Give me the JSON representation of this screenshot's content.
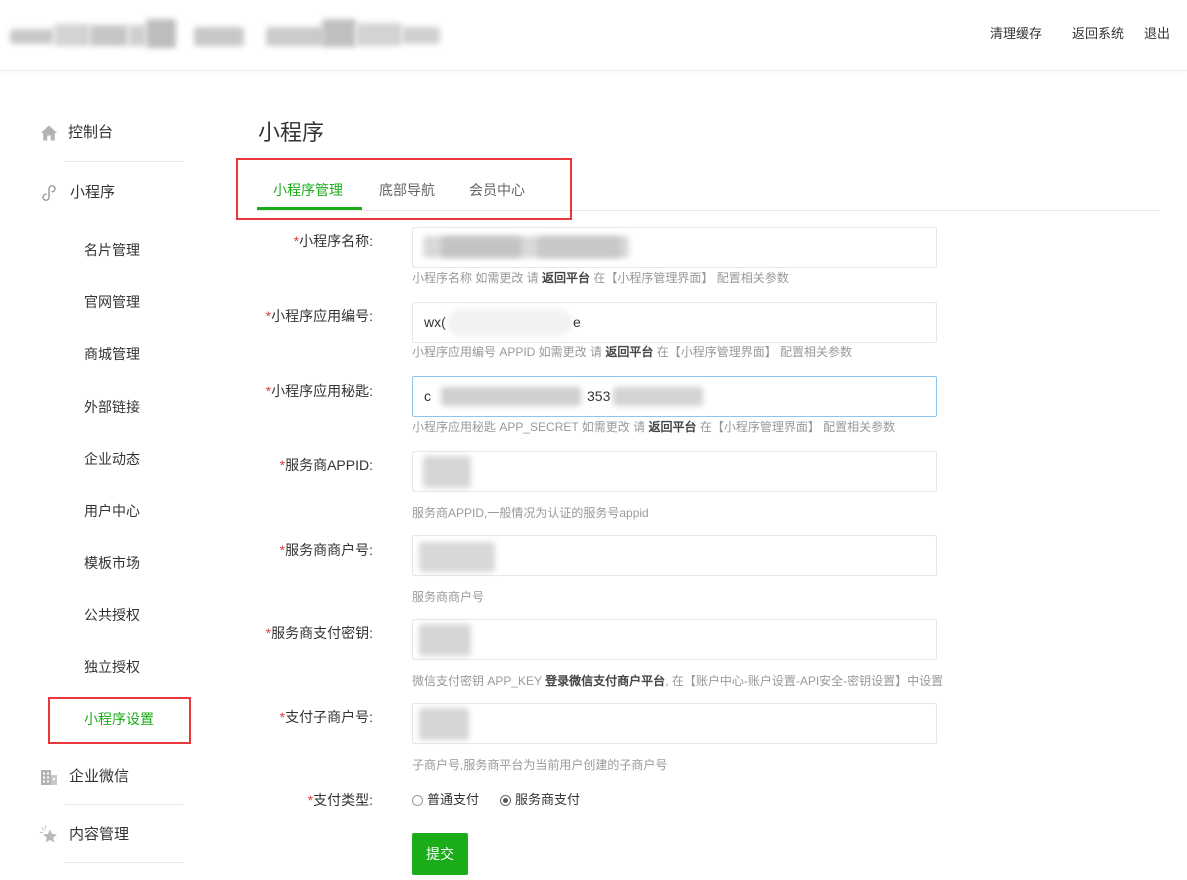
{
  "colors": {
    "accent": "#1AAD19",
    "required": "#E4393C",
    "highlight": "#E8363B",
    "help": "#999999",
    "focus_border": "#8EC4EE"
  },
  "header": {
    "clear_cache": "清理缓存",
    "back_to_system": "返回系统",
    "logout": "退出"
  },
  "sidebar": {
    "dashboard": {
      "label": "控制台",
      "icon": "home-icon"
    },
    "miniprogram": {
      "label": "小程序",
      "icon": "mini-program-icon",
      "items": [
        {
          "label": "名片管理",
          "active": false
        },
        {
          "label": "官网管理",
          "active": false
        },
        {
          "label": "商城管理",
          "active": false
        },
        {
          "label": "外部链接",
          "active": false
        },
        {
          "label": "企业动态",
          "active": false
        },
        {
          "label": "用户中心",
          "active": false
        },
        {
          "label": "模板市场",
          "active": false
        },
        {
          "label": "公共授权",
          "active": false
        },
        {
          "label": "独立授权",
          "active": false
        },
        {
          "label": "小程序设置",
          "active": true
        }
      ]
    },
    "wecom": {
      "label": "企业微信",
      "icon": "building-icon"
    },
    "content": {
      "label": "内容管理",
      "icon": "star-icon"
    }
  },
  "main": {
    "title": "小程序",
    "tabs": [
      {
        "label": "小程序管理",
        "active": true
      },
      {
        "label": "底部导航",
        "active": false
      },
      {
        "label": "会员中心",
        "active": false
      }
    ],
    "form": {
      "required_mark": "*",
      "fields": [
        {
          "label": "小程序名称:",
          "help_before": "小程序名称 如需更改 请 ",
          "help_strong": "返回平台",
          "help_after": " 在【小程序管理界面】 配置相关参数"
        },
        {
          "label": "小程序应用编号:",
          "value_start": "wx(",
          "value_end": "e",
          "help_before": "小程序应用编号 APPID 如需更改 请 ",
          "help_strong": "返回平台",
          "help_after": " 在【小程序管理界面】 配置相关参数"
        },
        {
          "label": "小程序应用秘匙:",
          "value_start": "c",
          "value_mid": "353",
          "help_before": "小程序应用秘匙 APP_SECRET 如需更改 请 ",
          "help_strong": "返回平台",
          "help_after": " 在【小程序管理界面】 配置相关参数"
        },
        {
          "label": "服务商APPID:",
          "help_before": "服务商APPID,一般情况为认证的服务号appid"
        },
        {
          "label": "服务商商户号:",
          "help_before": "服务商商户号"
        },
        {
          "label": "服务商支付密钥:",
          "help_before": "微信支付密钥 APP_KEY ",
          "help_strong": "登录微信支付商户平台",
          "help_after": ", 在【账户中心-账户设置-API安全-密钥设置】中设置"
        },
        {
          "label": "支付子商户号:",
          "help_before": "子商户号,服务商平台为当前用户创建的子商户号"
        }
      ],
      "pay_type": {
        "label": "支付类型:",
        "options": [
          {
            "label": "普通支付",
            "checked": false
          },
          {
            "label": "服务商支付",
            "checked": true
          }
        ]
      },
      "submit": "提交"
    }
  }
}
